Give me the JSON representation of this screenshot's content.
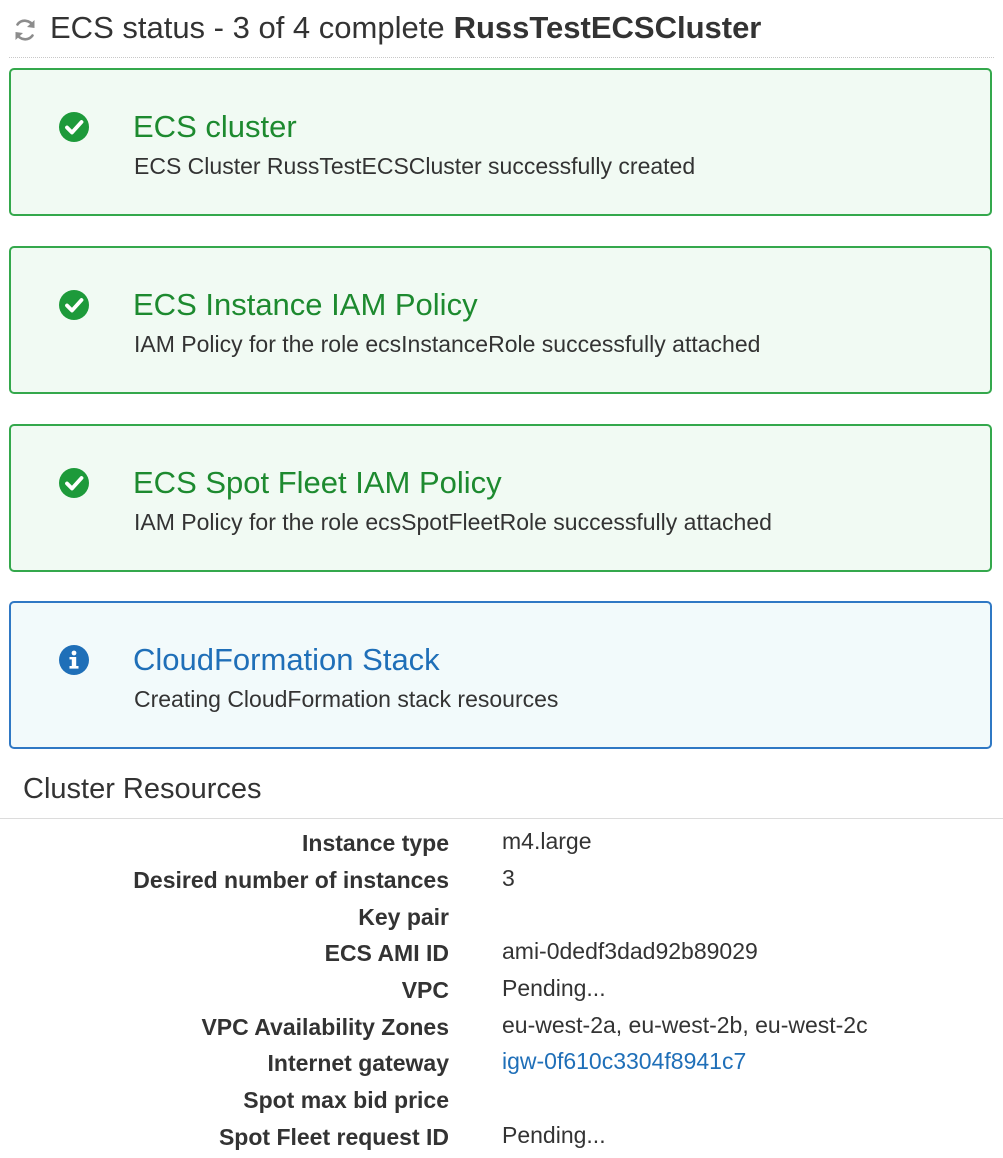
{
  "header": {
    "status_text": "ECS status - 3 of 4 complete",
    "cluster_name": "RussTestECSCluster",
    "icon": "refresh-icon"
  },
  "colors": {
    "success_border": "#34a84c",
    "success_bg": "#f1faf3",
    "success_text": "#1d8a2f",
    "info_border": "#2f78c4",
    "info_bg": "#f2fafb",
    "info_text": "#1f6fb8",
    "link": "#1f6fb8"
  },
  "steps": [
    {
      "status": "success",
      "icon": "check-circle-icon",
      "title": "ECS cluster",
      "description": "ECS Cluster RussTestECSCluster successfully created"
    },
    {
      "status": "success",
      "icon": "check-circle-icon",
      "title": "ECS Instance IAM Policy",
      "description": "IAM Policy for the role ecsInstanceRole successfully attached"
    },
    {
      "status": "success",
      "icon": "check-circle-icon",
      "title": "ECS Spot Fleet IAM Policy",
      "description": "IAM Policy for the role ecsSpotFleetRole successfully attached"
    },
    {
      "status": "info",
      "icon": "info-circle-icon",
      "title": "CloudFormation Stack",
      "description": "Creating CloudFormation stack resources"
    }
  ],
  "resources": {
    "title": "Cluster Resources",
    "rows": [
      {
        "label": "Instance type",
        "value": "m4.large"
      },
      {
        "label": "Desired number of instances",
        "value": "3"
      },
      {
        "label": "Key pair",
        "value": ""
      },
      {
        "label": "ECS AMI ID",
        "value": "ami-0dedf3dad92b89029"
      },
      {
        "label": "VPC",
        "value": "Pending..."
      },
      {
        "label": "VPC Availability Zones",
        "value": "eu-west-2a, eu-west-2b, eu-west-2c"
      },
      {
        "label": "Internet gateway",
        "value": "igw-0f610c3304f8941c7"
      },
      {
        "label": "Spot max bid price",
        "value": ""
      },
      {
        "label": "Spot Fleet request ID",
        "value": "Pending..."
      }
    ]
  }
}
